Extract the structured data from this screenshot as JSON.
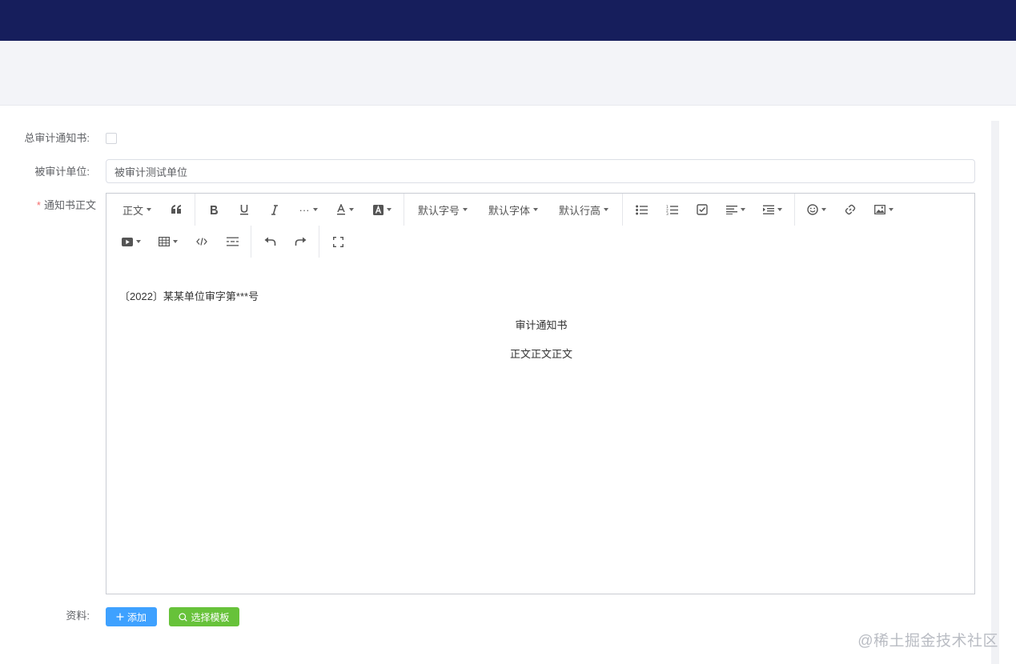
{
  "form": {
    "field_total_notice_label": "总审计通知书:",
    "field_unit_label": "被审计单位:",
    "field_unit_value": "被审计测试单位",
    "field_body_required_mark": "*",
    "field_body_label": "通知书正文",
    "field_materials_label": "资料:"
  },
  "toolbar": {
    "heading": "正文",
    "font_size": "默认字号",
    "font_family": "默认字体",
    "line_height": "默认行高",
    "more": "···"
  },
  "editor": {
    "ref_line": "〔2022〕某某单位审字第***号",
    "doc_title": "审计通知书",
    "body_text": "正文正文正文"
  },
  "buttons": {
    "add": "添加",
    "select_template": "选择模板"
  },
  "watermark": "@稀土掘金技术社区",
  "colors": {
    "topbar": "#161e5c",
    "primary": "#3ea1ff",
    "success": "#67c23a"
  }
}
